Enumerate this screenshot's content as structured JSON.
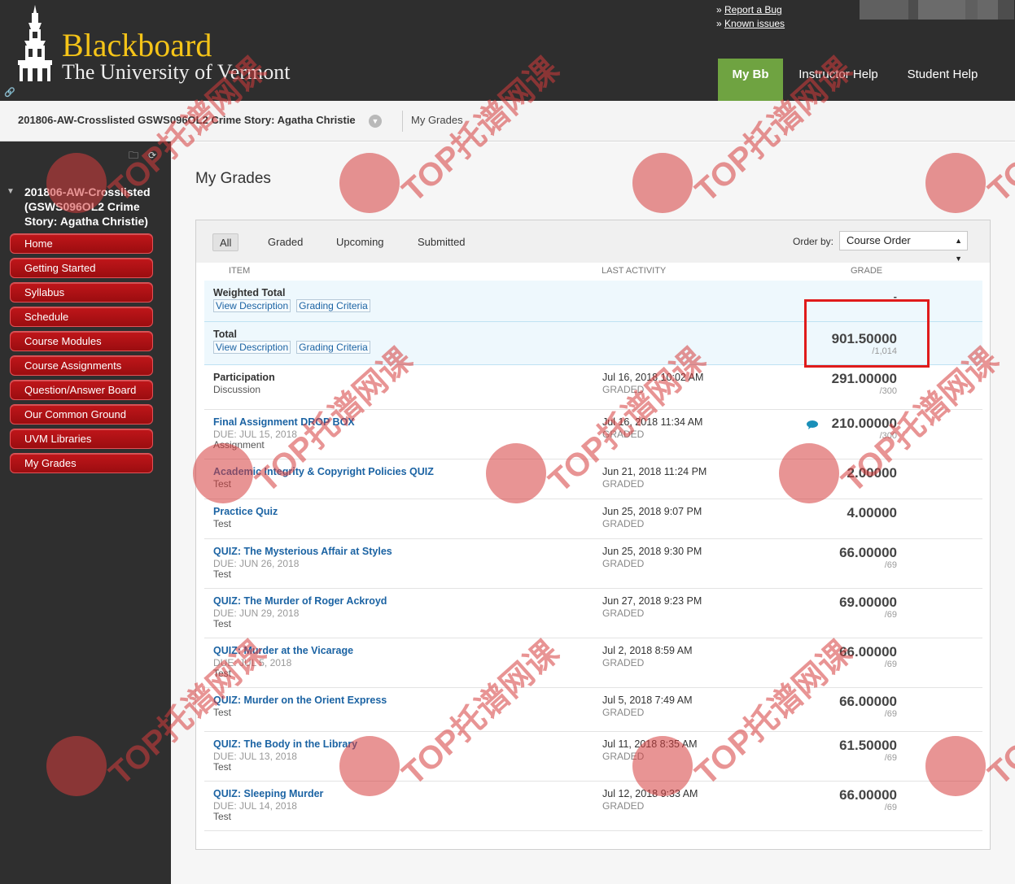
{
  "header": {
    "brand_name": "Blackboard",
    "brand_sub": "The University of Vermont",
    "report_bug": "Report a Bug",
    "known_issues": "Known issues",
    "tabs": [
      {
        "label": "My Bb"
      },
      {
        "label": "Instructor Help"
      },
      {
        "label": "Student Help"
      }
    ]
  },
  "breadcrumb": {
    "course": "201806-AW-Crosslisted GSWS096OL2 Crime Story: Agatha Christie",
    "current": "My Grades"
  },
  "sidebar": {
    "course_title": "201806-AW-Crosslisted (GSWS096OL2 Crime Story: Agatha Christie)",
    "items": [
      {
        "label": "Home"
      },
      {
        "label": "Getting Started"
      },
      {
        "label": "Syllabus"
      },
      {
        "label": "Schedule"
      },
      {
        "label": "Course Modules"
      },
      {
        "label": "Course Assignments"
      },
      {
        "label": "Question/Answer Board"
      },
      {
        "label": "Our Common Ground"
      },
      {
        "label": "UVM Libraries"
      },
      {
        "label": "My Grades"
      }
    ]
  },
  "main": {
    "title": "My Grades",
    "filters": {
      "all": "All",
      "graded": "Graded",
      "upcoming": "Upcoming",
      "submitted": "Submitted"
    },
    "order_label": "Order by:",
    "order_value": "Course Order",
    "columns": {
      "item": "ITEM",
      "activity": "LAST ACTIVITY",
      "grade": "GRADE"
    },
    "view_description": "View Description",
    "grading_criteria": "Grading Criteria",
    "rows": [
      {
        "title": "Weighted Total",
        "grade": "-"
      },
      {
        "title": "Total",
        "grade": "901.50000",
        "possible": "/1,014"
      },
      {
        "title": "Participation",
        "type": "Discussion",
        "activity": "Jul 16, 2018 10:02 AM",
        "status": "GRADED",
        "grade": "291.00000",
        "possible": "/300"
      },
      {
        "title": "Final Assignment DROP BOX",
        "due": "DUE: JUL 15, 2018",
        "type": "Assignment",
        "activity": "Jul 16, 2018 11:34 AM",
        "status": "GRADED",
        "grade": "210.00000",
        "possible": "/300"
      },
      {
        "title": "Academic Integrity & Copyright Policies QUIZ",
        "type": "Test",
        "activity": "Jun 21, 2018 11:24 PM",
        "status": "GRADED",
        "grade": "2.00000"
      },
      {
        "title": "Practice Quiz",
        "type": "Test",
        "activity": "Jun 25, 2018 9:07 PM",
        "status": "GRADED",
        "grade": "4.00000"
      },
      {
        "title": "QUIZ: The Mysterious Affair at Styles",
        "due": "DUE: JUN 26, 2018",
        "type": "Test",
        "activity": "Jun 25, 2018 9:30 PM",
        "status": "GRADED",
        "grade": "66.00000",
        "possible": "/69"
      },
      {
        "title": "QUIZ: The Murder of Roger Ackroyd",
        "due": "DUE: JUN 29, 2018",
        "type": "Test",
        "activity": "Jun 27, 2018 9:23 PM",
        "status": "GRADED",
        "grade": "69.00000",
        "possible": "/69"
      },
      {
        "title": "QUIZ: Murder at the Vicarage",
        "due": "DUE: JUL 5, 2018",
        "type": "Test",
        "activity": "Jul 2, 2018 8:59 AM",
        "status": "GRADED",
        "grade": "66.00000",
        "possible": "/69"
      },
      {
        "title": "QUIZ: Murder on the Orient Express",
        "type": "Test",
        "activity": "Jul 5, 2018 7:49 AM",
        "status": "GRADED",
        "grade": "66.00000",
        "possible": "/69"
      },
      {
        "title": "QUIZ: The Body in the Library",
        "due": "DUE: JUL 13, 2018",
        "type": "Test",
        "activity": "Jul 11, 2018 8:35 AM",
        "status": "GRADED",
        "grade": "61.50000",
        "possible": "/69"
      },
      {
        "title": "QUIZ: Sleeping Murder",
        "due": "DUE: JUL 14, 2018",
        "type": "Test",
        "activity": "Jul 12, 2018 9:33 AM",
        "status": "GRADED",
        "grade": "66.00000",
        "possible": "/69"
      }
    ]
  },
  "colors": {
    "header_bg": "#2e2e2e",
    "brand_gold": "#f5c418",
    "menu_red": "#b11217",
    "active_tab": "#6fa341",
    "link_blue": "#1b63a3",
    "highlight_red": "#e01b1b"
  },
  "icons": [
    "tower-logo-icon",
    "link-icon",
    "chevron-down-icon",
    "folder-icon",
    "refresh-icon",
    "collapse-arrow-icon",
    "comment-icon",
    "select-arrow-icon"
  ],
  "watermark": "TOP托谱网课"
}
